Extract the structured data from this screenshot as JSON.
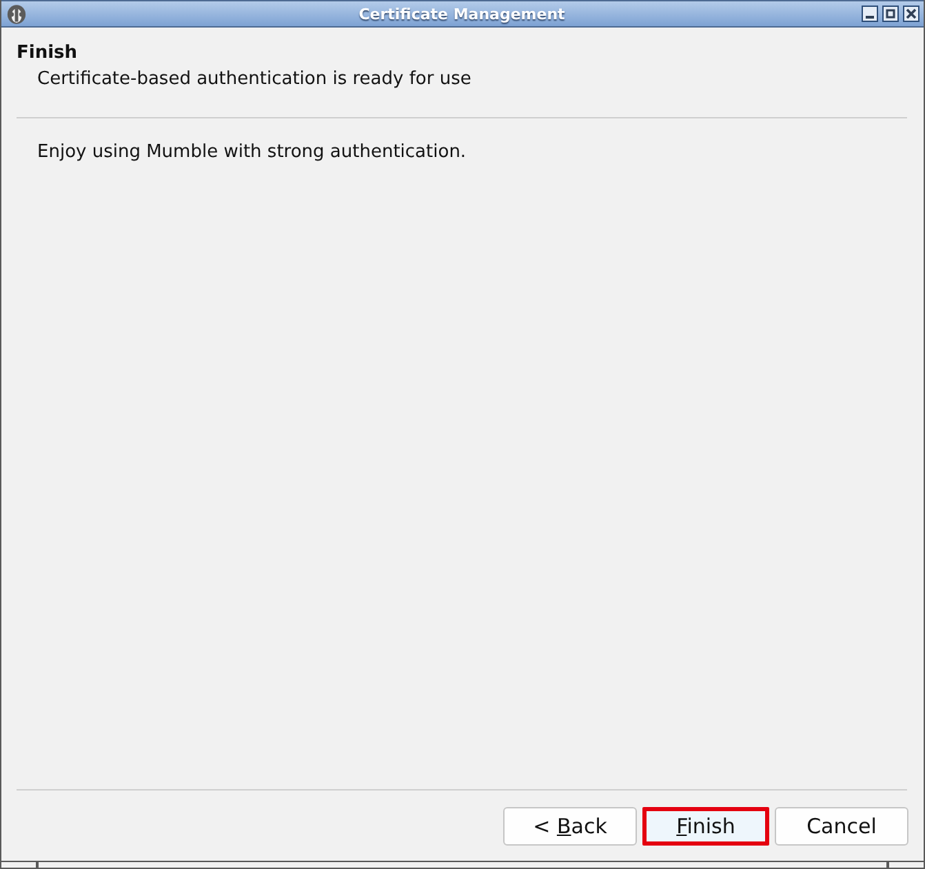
{
  "window": {
    "title": "Certificate Management"
  },
  "page": {
    "title": "Finish",
    "subtitle": "Certificate-based authentication is ready for use"
  },
  "body": {
    "text": "Enjoy using Mumble with strong authentication."
  },
  "buttons": [
    {
      "label": [
        {
          "text": "< ",
          "underlined": false
        },
        {
          "text": "B",
          "underlined": true
        },
        {
          "text": "ack",
          "underlined": false
        }
      ],
      "highlighted": false
    },
    {
      "label": [
        {
          "text": "F",
          "underlined": true
        },
        {
          "text": "inish",
          "underlined": false
        }
      ],
      "highlighted": true
    },
    {
      "label": [
        {
          "text": "Cancel",
          "underlined": false
        }
      ],
      "highlighted": false
    }
  ]
}
